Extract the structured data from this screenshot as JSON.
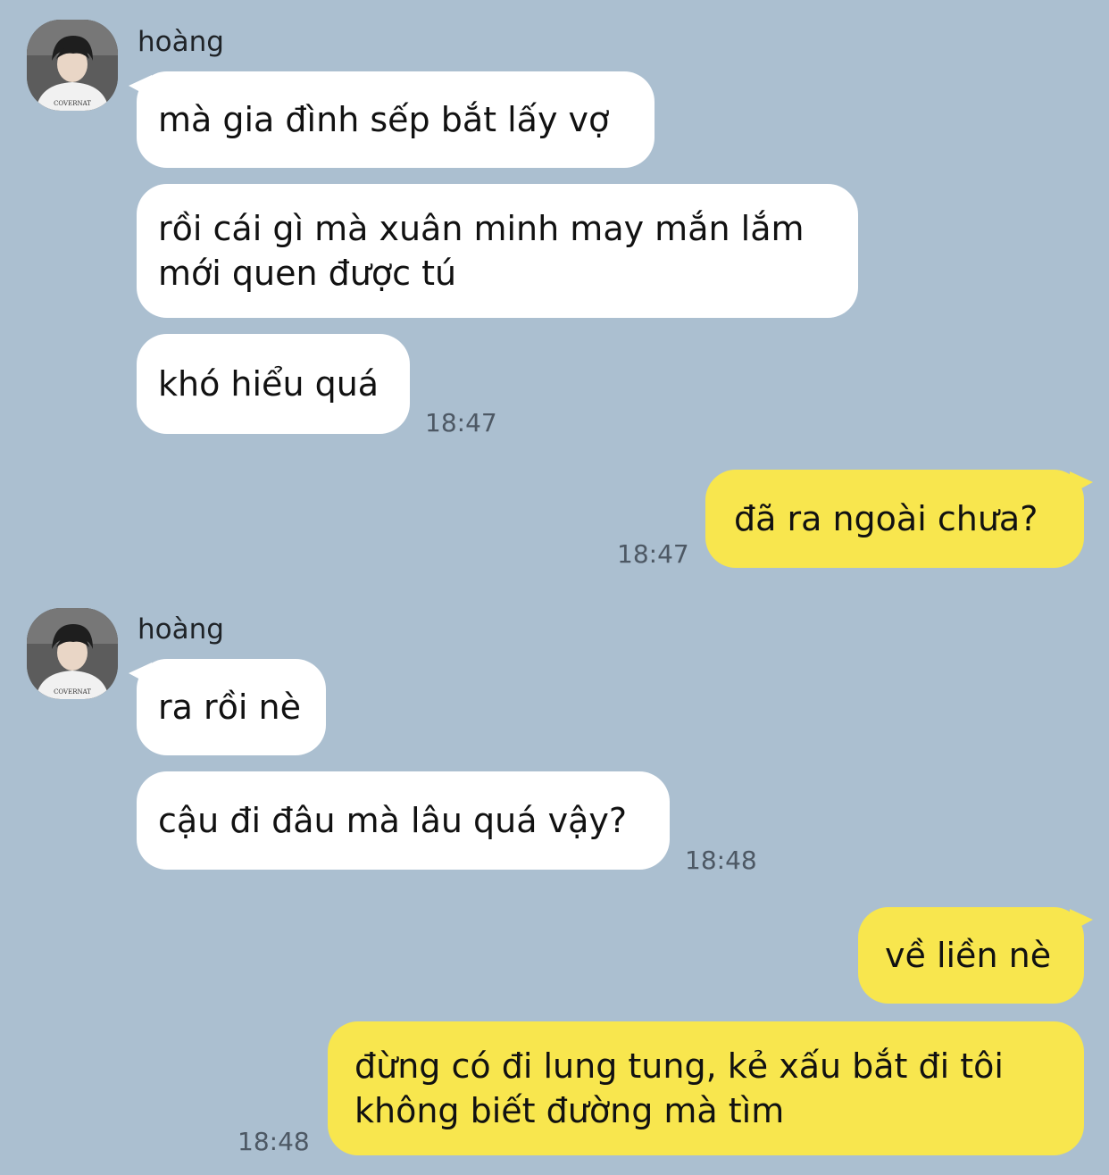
{
  "chat": {
    "groups": [
      {
        "sender": "hoàng",
        "avatar_icon": "user-photo-avatar",
        "messages": [
          "mà gia đình sếp bắt lấy vợ",
          "rồi cái gì mà xuân minh may mắn lắm mới quen được tú",
          "khó hiểu quá"
        ],
        "time": "18:47"
      },
      {
        "sender": "me",
        "messages": [
          "đã ra ngoài chưa?"
        ],
        "time": "18:47"
      },
      {
        "sender": "hoàng",
        "avatar_icon": "user-photo-avatar",
        "messages": [
          "ra rồi nè",
          "cậu đi đâu mà lâu quá vậy?"
        ],
        "time": "18:48"
      },
      {
        "sender": "me",
        "messages": [
          "về liền nè",
          "đừng có đi lung tung, kẻ xấu bắt đi tôi không biết đường mà tìm"
        ],
        "time": "18:48"
      }
    ]
  },
  "colors": {
    "background": "#abbfd0",
    "incoming_bubble": "#ffffff",
    "outgoing_bubble": "#f8e64e"
  }
}
